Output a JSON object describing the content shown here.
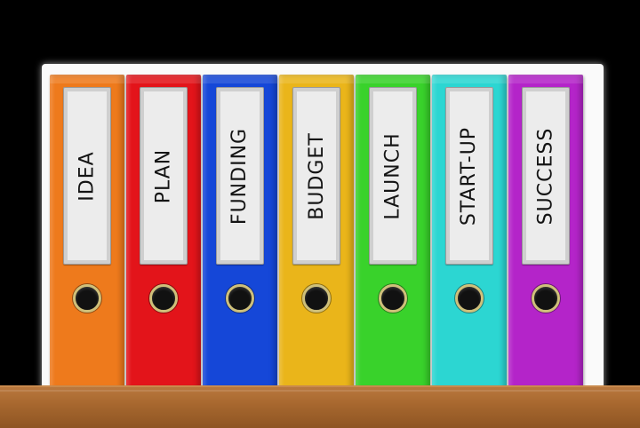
{
  "binders": [
    {
      "label": "IDEA",
      "color": "#ee7a1c"
    },
    {
      "label": "PLAN",
      "color": "#e3141a"
    },
    {
      "label": "FUNDING",
      "color": "#1547d8"
    },
    {
      "label": "BUDGET",
      "color": "#eab51a"
    },
    {
      "label": "LAUNCH",
      "color": "#39d22b"
    },
    {
      "label": "START-UP",
      "color": "#2cd6d2"
    },
    {
      "label": "SUCCESS",
      "color": "#b424c9"
    }
  ],
  "colors": {
    "backboard": "#fafafa",
    "shelf": "#a8682f",
    "label_paper": "#ececec",
    "ring": "#cfc07a"
  }
}
